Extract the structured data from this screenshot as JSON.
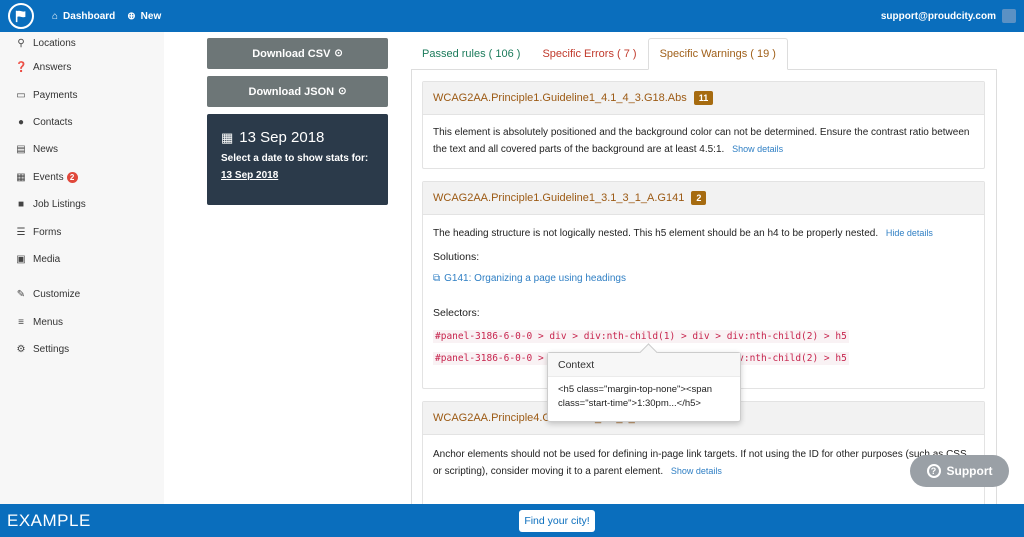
{
  "topbar": {
    "dashboard_label": "Dashboard",
    "new_label": "New",
    "user_email": "support@proudcity.com"
  },
  "sidebar": {
    "items": [
      {
        "label": "Locations",
        "icon": "map-marker-icon"
      },
      {
        "label": "Answers",
        "icon": "question-circle-icon"
      },
      {
        "label": "Payments",
        "icon": "credit-card-icon"
      },
      {
        "label": "Contacts",
        "icon": "user-icon"
      },
      {
        "label": "News",
        "icon": "newspaper-icon"
      },
      {
        "label": "Events",
        "icon": "calendar-icon",
        "badge": "2"
      },
      {
        "label": "Job Listings",
        "icon": "briefcase-icon"
      },
      {
        "label": "Forms",
        "icon": "database-icon"
      },
      {
        "label": "Media",
        "icon": "image-icon"
      },
      {
        "label": "Customize",
        "icon": "brush-icon"
      },
      {
        "label": "Menus",
        "icon": "bars-icon"
      },
      {
        "label": "Settings",
        "icon": "cogs-icon"
      }
    ]
  },
  "downloads": {
    "csv_label": "Download CSV",
    "json_label": "Download JSON"
  },
  "date_card": {
    "date": "13 Sep 2018",
    "prompt": "Select a date to show stats for:",
    "selected": "13 Sep 2018"
  },
  "tabs": {
    "passed": "Passed rules ( 106 )",
    "errors": "Specific Errors ( 7 )",
    "warnings": "Specific Warnings ( 19 )"
  },
  "issues": [
    {
      "code": "WCAG2AA.Principle1.Guideline1_4.1_4_3.G18.Abs",
      "count": "11",
      "description": "This element is absolutely positioned and the background color can not be determined. Ensure the contrast ratio between the text and all covered parts of the background are at least 4.5:1.",
      "toggle": "Show details"
    },
    {
      "code": "WCAG2AA.Principle1.Guideline1_3.1_3_1_A.G141",
      "count": "2",
      "description": "The heading structure is not logically nested. This h5 element should be an h4 to be properly nested.",
      "toggle": "Hide details",
      "solutions_label": "Solutions:",
      "solution_link": "G141: Organizing a page using headings",
      "selectors_label": "Selectors:",
      "selectors": [
        "#panel-3186-6-0-0 > div > div:nth-child(1) > div > div:nth-child(2) > h5",
        "#panel-3186-6-0-0 > div > div:nth-child(2) > div > div:nth-child(2) > h5"
      ]
    },
    {
      "code": "WCAG2AA.Principle4.Guideline4_1.4_1_2.H91",
      "count": "",
      "description": "Anchor elements should not be used for defining in-page link targets. If not using the ID for other purposes (such as CSS or scripting), consider moving it to a parent element.",
      "toggle": "Show details"
    }
  ],
  "popover": {
    "title": "Context",
    "body": "<h5 class=\"margin-top-none\"><span class=\"start-time\">1:30pm...</h5>"
  },
  "support_label": "Support",
  "bottombar": {
    "example_label": "EXAMPLE",
    "find_label": "Find your city!"
  }
}
